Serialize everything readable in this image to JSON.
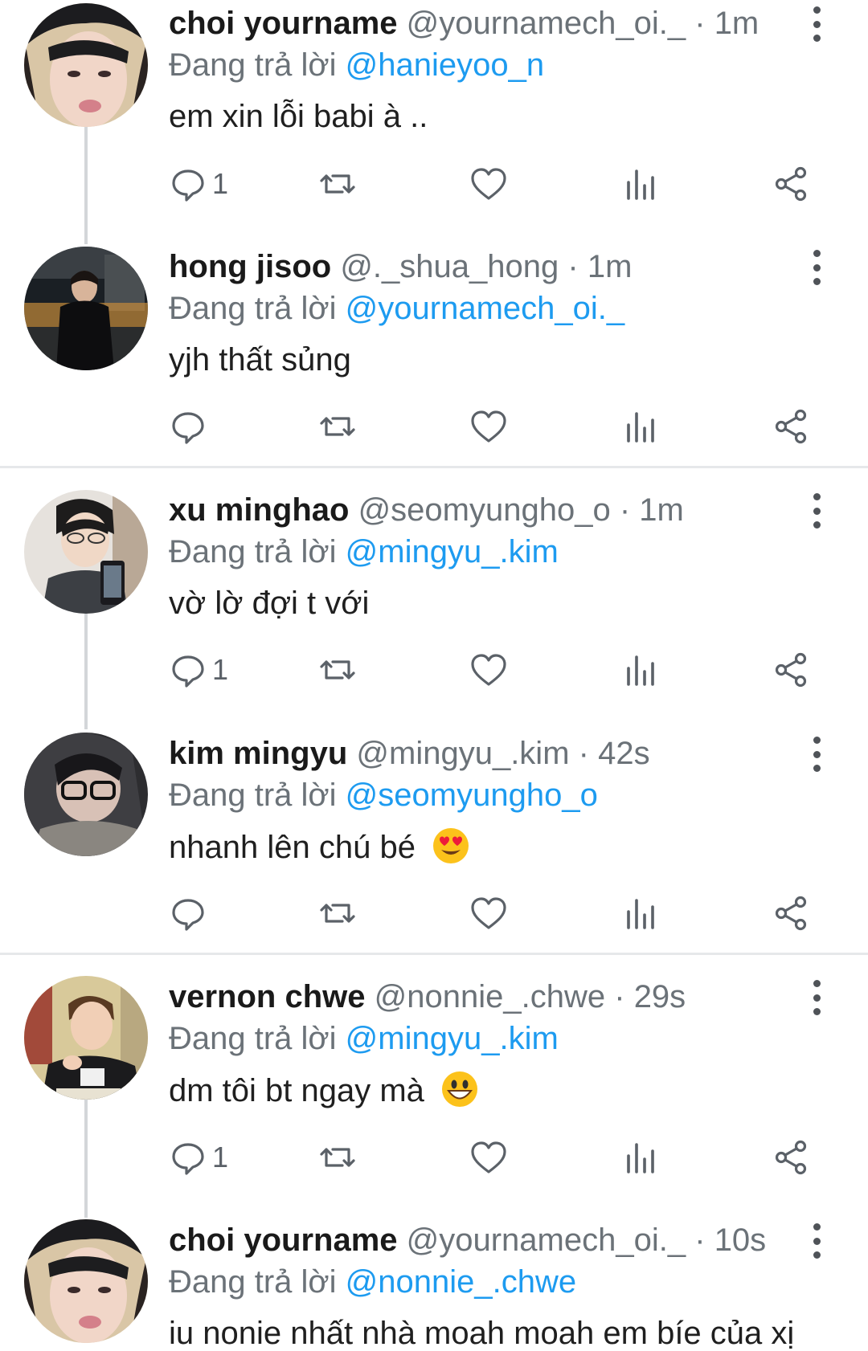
{
  "tweets": [
    {
      "name": "choi yourname",
      "handle": "@yournamech_oi._",
      "time": "1m",
      "reply_prefix": "Đang trả lời",
      "reply_to": "@hanieyoo_n",
      "text": "em xin lỗi babi à ..",
      "reply_count": "1",
      "emoji": ""
    },
    {
      "name": "hong jisoo",
      "handle": "@._shua_hong",
      "time": "1m",
      "reply_prefix": "Đang trả lời",
      "reply_to": "@yournamech_oi._",
      "text": "yjh thất sủng",
      "reply_count": "",
      "emoji": ""
    },
    {
      "name": "xu minghao",
      "handle": "@seomyungho_o",
      "time": "1m",
      "reply_prefix": "Đang trả lời",
      "reply_to": "@mingyu_.kim",
      "text": "vờ lờ đợi t với",
      "reply_count": "1",
      "emoji": ""
    },
    {
      "name": "kim mingyu",
      "handle": "@mingyu_.kim",
      "time": "42s",
      "reply_prefix": "Đang trả lời",
      "reply_to": "@seomyungho_o",
      "text": "nhanh lên chú bé",
      "reply_count": "",
      "emoji": "heart-eyes"
    },
    {
      "name": "vernon chwe",
      "handle": "@nonnie_.chwe",
      "time": "29s",
      "reply_prefix": "Đang trả lời",
      "reply_to": "@mingyu_.kim",
      "text": "dm tôi bt ngay mà",
      "reply_count": "1",
      "emoji": "grin"
    },
    {
      "name": "choi yourname",
      "handle": "@yournamech_oi._",
      "time": "10s",
      "reply_prefix": "Đang trả lời",
      "reply_to": "@nonnie_.chwe",
      "text": "iu nonie nhất nhà moah moah em bíe của xị",
      "reply_count": "",
      "emoji": ""
    }
  ],
  "separator": "·",
  "colors": {
    "link": "#1d9bf0",
    "muted": "#6b7278",
    "divider": "#e6e8ea",
    "thread_line": "#d3d6d9"
  }
}
